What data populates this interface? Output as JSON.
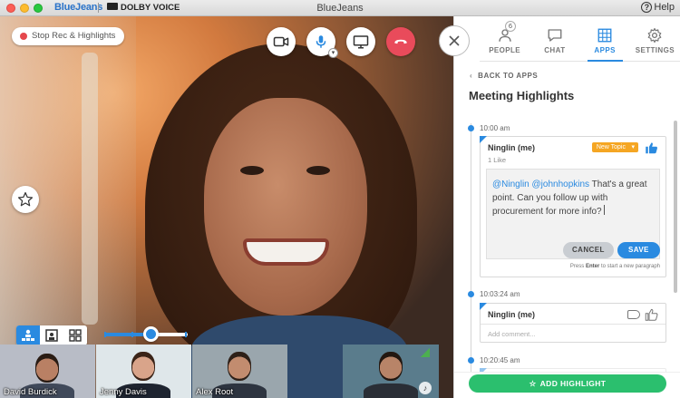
{
  "window": {
    "title": "BlueJeans",
    "brand": "BlueJeans",
    "dolby": "DOLBY VOICE",
    "help": "Help",
    "help_icon": "?"
  },
  "video": {
    "record_label": "Stop Rec & Highlights",
    "zoom_level": 0.55,
    "participants": [
      {
        "name": "David Burdick",
        "bg": "#b8bcc6",
        "skin": "#b98064",
        "hair": "#2a1c14",
        "shirt": "#40495a"
      },
      {
        "name": "Jenny Davis",
        "bg": "#dfe7ea",
        "skin": "#d9a48a",
        "hair": "#3b2418",
        "shirt": "#1e2430"
      },
      {
        "name": "Alex Root",
        "bg": "#9aa6ad",
        "skin": "#c28c6f",
        "hair": "#2e2018",
        "shirt": "#2d3440"
      },
      {
        "name": "",
        "bg": "#5a7c8c",
        "skin": "#b88468",
        "hair": "#231710",
        "shirt": "#2a2e36"
      }
    ]
  },
  "panel": {
    "tabs": [
      {
        "label": "PEOPLE",
        "icon": "people-icon",
        "badge": "6",
        "active": false
      },
      {
        "label": "CHAT",
        "icon": "chat-icon",
        "active": false
      },
      {
        "label": "APPS",
        "icon": "apps-icon",
        "active": true
      },
      {
        "label": "SETTINGS",
        "icon": "gear-icon",
        "active": false
      }
    ],
    "back_label": "BACK TO APPS",
    "title": "Meeting Highlights",
    "highlights": [
      {
        "time": "10:00 am",
        "author": "Ninglin (me)",
        "likes": "1 Like",
        "topic": "New Topic",
        "mention1": "@Ninglin",
        "mention2": "@johnhopkins",
        "text": " That's a great point. Can you follow up with procurement for more info?",
        "cancel": "CANCEL",
        "save": "SAVE",
        "hint_pre": "Press ",
        "hint_key": "Enter",
        "hint_post": " to start a new paragraph"
      },
      {
        "time": "10:03:24 am",
        "author": "Ninglin (me)",
        "comment_placeholder": "Add comment..."
      },
      {
        "time": "10:20:45 am"
      }
    ],
    "add_highlight": "ADD HIGHLIGHT"
  },
  "colors": {
    "accent": "#2a8ae0",
    "hangup": "#e94b5b",
    "topic": "#f5a623",
    "add": "#2bbf6e"
  }
}
